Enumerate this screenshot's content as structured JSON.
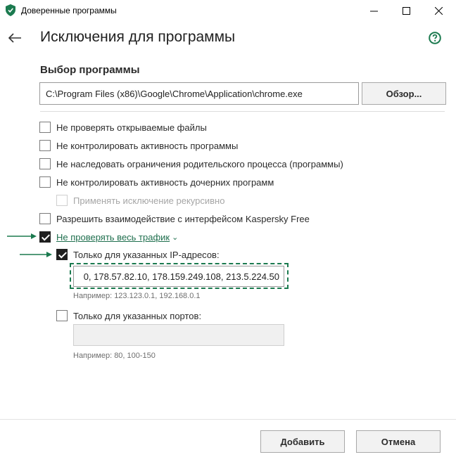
{
  "window": {
    "title": "Доверенные программы",
    "accent_color": "#1b7a4f"
  },
  "header": {
    "title": "Исключения для программы"
  },
  "program": {
    "section_label": "Выбор программы",
    "path_value": "C:\\Program Files (x86)\\Google\\Chrome\\Application\\chrome.exe",
    "browse_label": "Обзор..."
  },
  "options": [
    {
      "label": "Не проверять открываемые файлы",
      "checked": false
    },
    {
      "label": "Не контролировать активность программы",
      "checked": false
    },
    {
      "label": "Не наследовать ограничения родительского процесса (программы)",
      "checked": false
    },
    {
      "label": "Не контролировать активность дочерних программ",
      "checked": false
    },
    {
      "label": "Применять исключение рекурсивно",
      "checked": false,
      "disabled": true
    },
    {
      "label": "Разрешить взаимодействие с интерфейсом Kaspersky Free",
      "checked": false
    },
    {
      "label": "Не проверять весь трафик",
      "checked": true,
      "link": true
    }
  ],
  "traffic": {
    "ip_label": "Только для указанных IP-адресов:",
    "ip_checked": true,
    "ip_value": "0, 178.57.82.10, 178.159.249.108, 213.5.224.50",
    "ip_hint": "Например: 123.123.0.1, 192.168.0.1",
    "ports_label": "Только для указанных портов:",
    "ports_checked": false,
    "ports_value": "",
    "ports_hint": "Например: 80, 100-150"
  },
  "footer": {
    "add_label": "Добавить",
    "cancel_label": "Отмена"
  }
}
